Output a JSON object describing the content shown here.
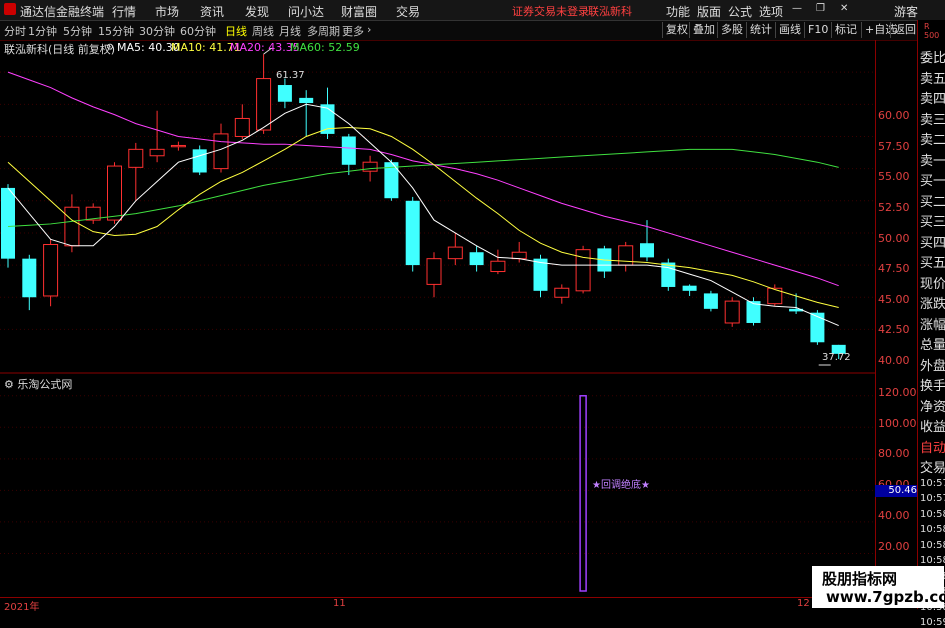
{
  "menubar": {
    "app_title": "通达信金融终端",
    "items": [
      "行情",
      "市场",
      "资讯",
      "发现",
      "问小达",
      "财富圈",
      "交易"
    ],
    "warning": "证券交易未登录",
    "stock": "联泓新科",
    "right_items": [
      "功能",
      "版面",
      "公式",
      "选项"
    ],
    "guest": "游客"
  },
  "tabs": [
    "分时",
    "1分钟",
    "5分钟",
    "15分钟",
    "30分钟",
    "60分钟",
    "日线",
    "周线",
    "月线",
    "多周期",
    "更多"
  ],
  "active_tab": "日线",
  "toolbar": [
    "复权",
    "叠加",
    "多股",
    "统计",
    "画线",
    "F10",
    "标记",
    "+自选",
    "返回"
  ],
  "legend": {
    "name": "联泓新科(日线 前复权)",
    "ma5": "MA5: 40.30",
    "ma10": "MA10: 41.71",
    "ma20": "MA20: 43.35",
    "ma60": "MA60: 52.59"
  },
  "colors": {
    "ma5": "#ffffff",
    "ma10": "#ffff40",
    "ma20": "#ff40ff",
    "ma60": "#40e040",
    "up": "#ff3030",
    "down": "#40ffff",
    "axis": "#e04040"
  },
  "price_axis": [
    "60.00",
    "57.50",
    "55.00",
    "52.50",
    "50.00",
    "47.50",
    "45.00",
    "42.50",
    "40.00"
  ],
  "sub_axis": [
    "120.00",
    "100.00",
    "80.00",
    "60.00",
    "40.00",
    "20.00"
  ],
  "high_label": "61.37",
  "low_label": "37.72",
  "sub_legend": "乐淘公式网",
  "signal_label": "★回调绝底★",
  "sub_value": "50.46",
  "dates": [
    "2021年",
    "11",
    "12"
  ],
  "right_panel": {
    "top": "R 500",
    "labels": [
      "委比",
      "卖五",
      "卖四",
      "卖三",
      "卖二",
      "卖一",
      "买一",
      "买二",
      "买三",
      "买四",
      "买五",
      "现价",
      "涨跌",
      "涨幅",
      "总量",
      "外盘",
      "换手",
      "净资",
      "收益",
      "自动",
      "交易",
      "10:57",
      "10:57",
      "10:58",
      "10:58",
      "10:58",
      "10:58",
      "10:58",
      "10:58",
      "10:58",
      "10:59"
    ]
  },
  "watermark": {
    "line1": "股朋指标网",
    "line2": "www.7gpzb.com"
  },
  "chart_data": {
    "type": "candlestick",
    "ylim": [
      37.0,
      62.5
    ],
    "candles": [
      {
        "o": 51.0,
        "c": 45.5,
        "h": 51.3,
        "l": 44.8
      },
      {
        "o": 45.5,
        "c": 42.5,
        "h": 45.8,
        "l": 41.5
      },
      {
        "o": 42.6,
        "c": 46.6,
        "h": 47.0,
        "l": 41.8
      },
      {
        "o": 46.5,
        "c": 49.5,
        "h": 50.5,
        "l": 46.0
      },
      {
        "o": 48.5,
        "c": 49.5,
        "h": 49.8,
        "l": 48.2
      },
      {
        "o": 48.5,
        "c": 52.7,
        "h": 53.0,
        "l": 48.2
      },
      {
        "o": 52.6,
        "c": 54.0,
        "h": 54.5,
        "l": 50.0
      },
      {
        "o": 53.5,
        "c": 54.0,
        "h": 57.0,
        "l": 53.0
      },
      {
        "o": 54.2,
        "c": 54.3,
        "h": 54.6,
        "l": 53.9
      },
      {
        "o": 54.0,
        "c": 52.2,
        "h": 54.3,
        "l": 52.0
      },
      {
        "o": 52.5,
        "c": 55.2,
        "h": 56.0,
        "l": 52.2
      },
      {
        "o": 55.0,
        "c": 56.4,
        "h": 57.5,
        "l": 54.8
      },
      {
        "o": 55.5,
        "c": 59.5,
        "h": 61.4,
        "l": 55.2
      },
      {
        "o": 59.0,
        "c": 57.7,
        "h": 59.5,
        "l": 57.2
      },
      {
        "o": 58.0,
        "c": 57.6,
        "h": 58.6,
        "l": 55.0
      },
      {
        "o": 57.5,
        "c": 55.2,
        "h": 58.8,
        "l": 54.8
      },
      {
        "o": 55.0,
        "c": 52.8,
        "h": 55.2,
        "l": 52.0
      },
      {
        "o": 52.3,
        "c": 53.0,
        "h": 53.5,
        "l": 51.5
      },
      {
        "o": 53.0,
        "c": 50.2,
        "h": 53.2,
        "l": 50.0
      },
      {
        "o": 50.0,
        "c": 45.0,
        "h": 50.3,
        "l": 44.5
      },
      {
        "o": 43.5,
        "c": 45.5,
        "h": 46.0,
        "l": 42.5
      },
      {
        "o": 45.5,
        "c": 46.4,
        "h": 47.5,
        "l": 45.0
      },
      {
        "o": 46.0,
        "c": 45.0,
        "h": 46.5,
        "l": 44.5
      },
      {
        "o": 44.5,
        "c": 45.3,
        "h": 46.2,
        "l": 44.3
      },
      {
        "o": 45.5,
        "c": 46.0,
        "h": 46.8,
        "l": 45.2
      },
      {
        "o": 45.5,
        "c": 43.0,
        "h": 45.8,
        "l": 42.5
      },
      {
        "o": 42.5,
        "c": 43.2,
        "h": 43.5,
        "l": 42.0
      },
      {
        "o": 43.0,
        "c": 46.2,
        "h": 46.5,
        "l": 42.8
      },
      {
        "o": 46.3,
        "c": 44.5,
        "h": 46.5,
        "l": 44.0
      },
      {
        "o": 45.0,
        "c": 46.5,
        "h": 46.8,
        "l": 44.5
      },
      {
        "o": 46.7,
        "c": 45.6,
        "h": 48.5,
        "l": 45.3
      },
      {
        "o": 45.2,
        "c": 43.3,
        "h": 45.5,
        "l": 43.0
      },
      {
        "o": 43.4,
        "c": 43.0,
        "h": 43.5,
        "l": 42.6
      },
      {
        "o": 42.8,
        "c": 41.6,
        "h": 43.0,
        "l": 41.4
      },
      {
        "o": 40.5,
        "c": 42.2,
        "h": 42.5,
        "l": 40.2
      },
      {
        "o": 42.2,
        "c": 40.5,
        "h": 42.5,
        "l": 40.3
      },
      {
        "o": 42.0,
        "c": 43.2,
        "h": 43.5,
        "l": 41.8
      },
      {
        "o": 41.6,
        "c": 41.4,
        "h": 42.8,
        "l": 41.2
      },
      {
        "o": 41.3,
        "c": 39.0,
        "h": 41.5,
        "l": 38.8
      },
      {
        "o": 38.8,
        "c": 38.1,
        "h": 38.8,
        "l": 37.7
      }
    ],
    "ma5": [
      51.0,
      49.0,
      47.0,
      46.5,
      46.5,
      48.0,
      50.0,
      51.5,
      53.0,
      53.5,
      54.0,
      54.7,
      55.7,
      56.8,
      57.5,
      57.2,
      56.0,
      54.5,
      53.0,
      51.0,
      48.5,
      47.5,
      46.5,
      45.6,
      45.5,
      45.2,
      45.0,
      45.0,
      45.0,
      45.0,
      45.0,
      44.8,
      44.3,
      43.8,
      42.9,
      42.0,
      41.8,
      41.7,
      41.0,
      40.3
    ],
    "ma10": [
      53.0,
      51.5,
      50.0,
      48.5,
      47.6,
      47.3,
      47.4,
      48.0,
      49.3,
      50.5,
      51.5,
      52.2,
      53.1,
      54.0,
      55.0,
      55.6,
      55.7,
      55.6,
      55.0,
      54.0,
      52.8,
      51.5,
      50.2,
      49.0,
      47.7,
      46.7,
      46.0,
      45.6,
      45.4,
      45.3,
      45.2,
      45.0,
      44.8,
      44.5,
      44.2,
      43.7,
      43.1,
      42.6,
      42.1,
      41.7
    ],
    "ma20": [
      60.0,
      59.4,
      58.8,
      58.0,
      57.3,
      56.7,
      56.0,
      55.5,
      55.0,
      54.8,
      54.6,
      54.5,
      54.4,
      54.4,
      54.3,
      54.2,
      54.1,
      54.0,
      53.6,
      53.1,
      52.8,
      52.5,
      52.1,
      51.6,
      51.0,
      50.4,
      49.8,
      49.3,
      48.8,
      48.4,
      48.0,
      47.5,
      47.0,
      46.5,
      46.0,
      45.5,
      45.0,
      44.5,
      44.0,
      43.4
    ],
    "ma60": [
      48.0,
      48.1,
      48.2,
      48.4,
      48.6,
      48.8,
      49.0,
      49.3,
      49.6,
      50.0,
      50.4,
      50.8,
      51.2,
      51.5,
      51.8,
      52.1,
      52.3,
      52.5,
      52.6,
      52.7,
      52.8,
      52.9,
      53.0,
      53.1,
      53.2,
      53.3,
      53.4,
      53.5,
      53.6,
      53.7,
      53.8,
      53.9,
      54.0,
      54.0,
      54.0,
      53.8,
      53.6,
      53.3,
      53.0,
      52.6
    ],
    "sub_ylim": [
      0,
      130
    ],
    "signal": {
      "index": 27,
      "top": 120
    }
  }
}
